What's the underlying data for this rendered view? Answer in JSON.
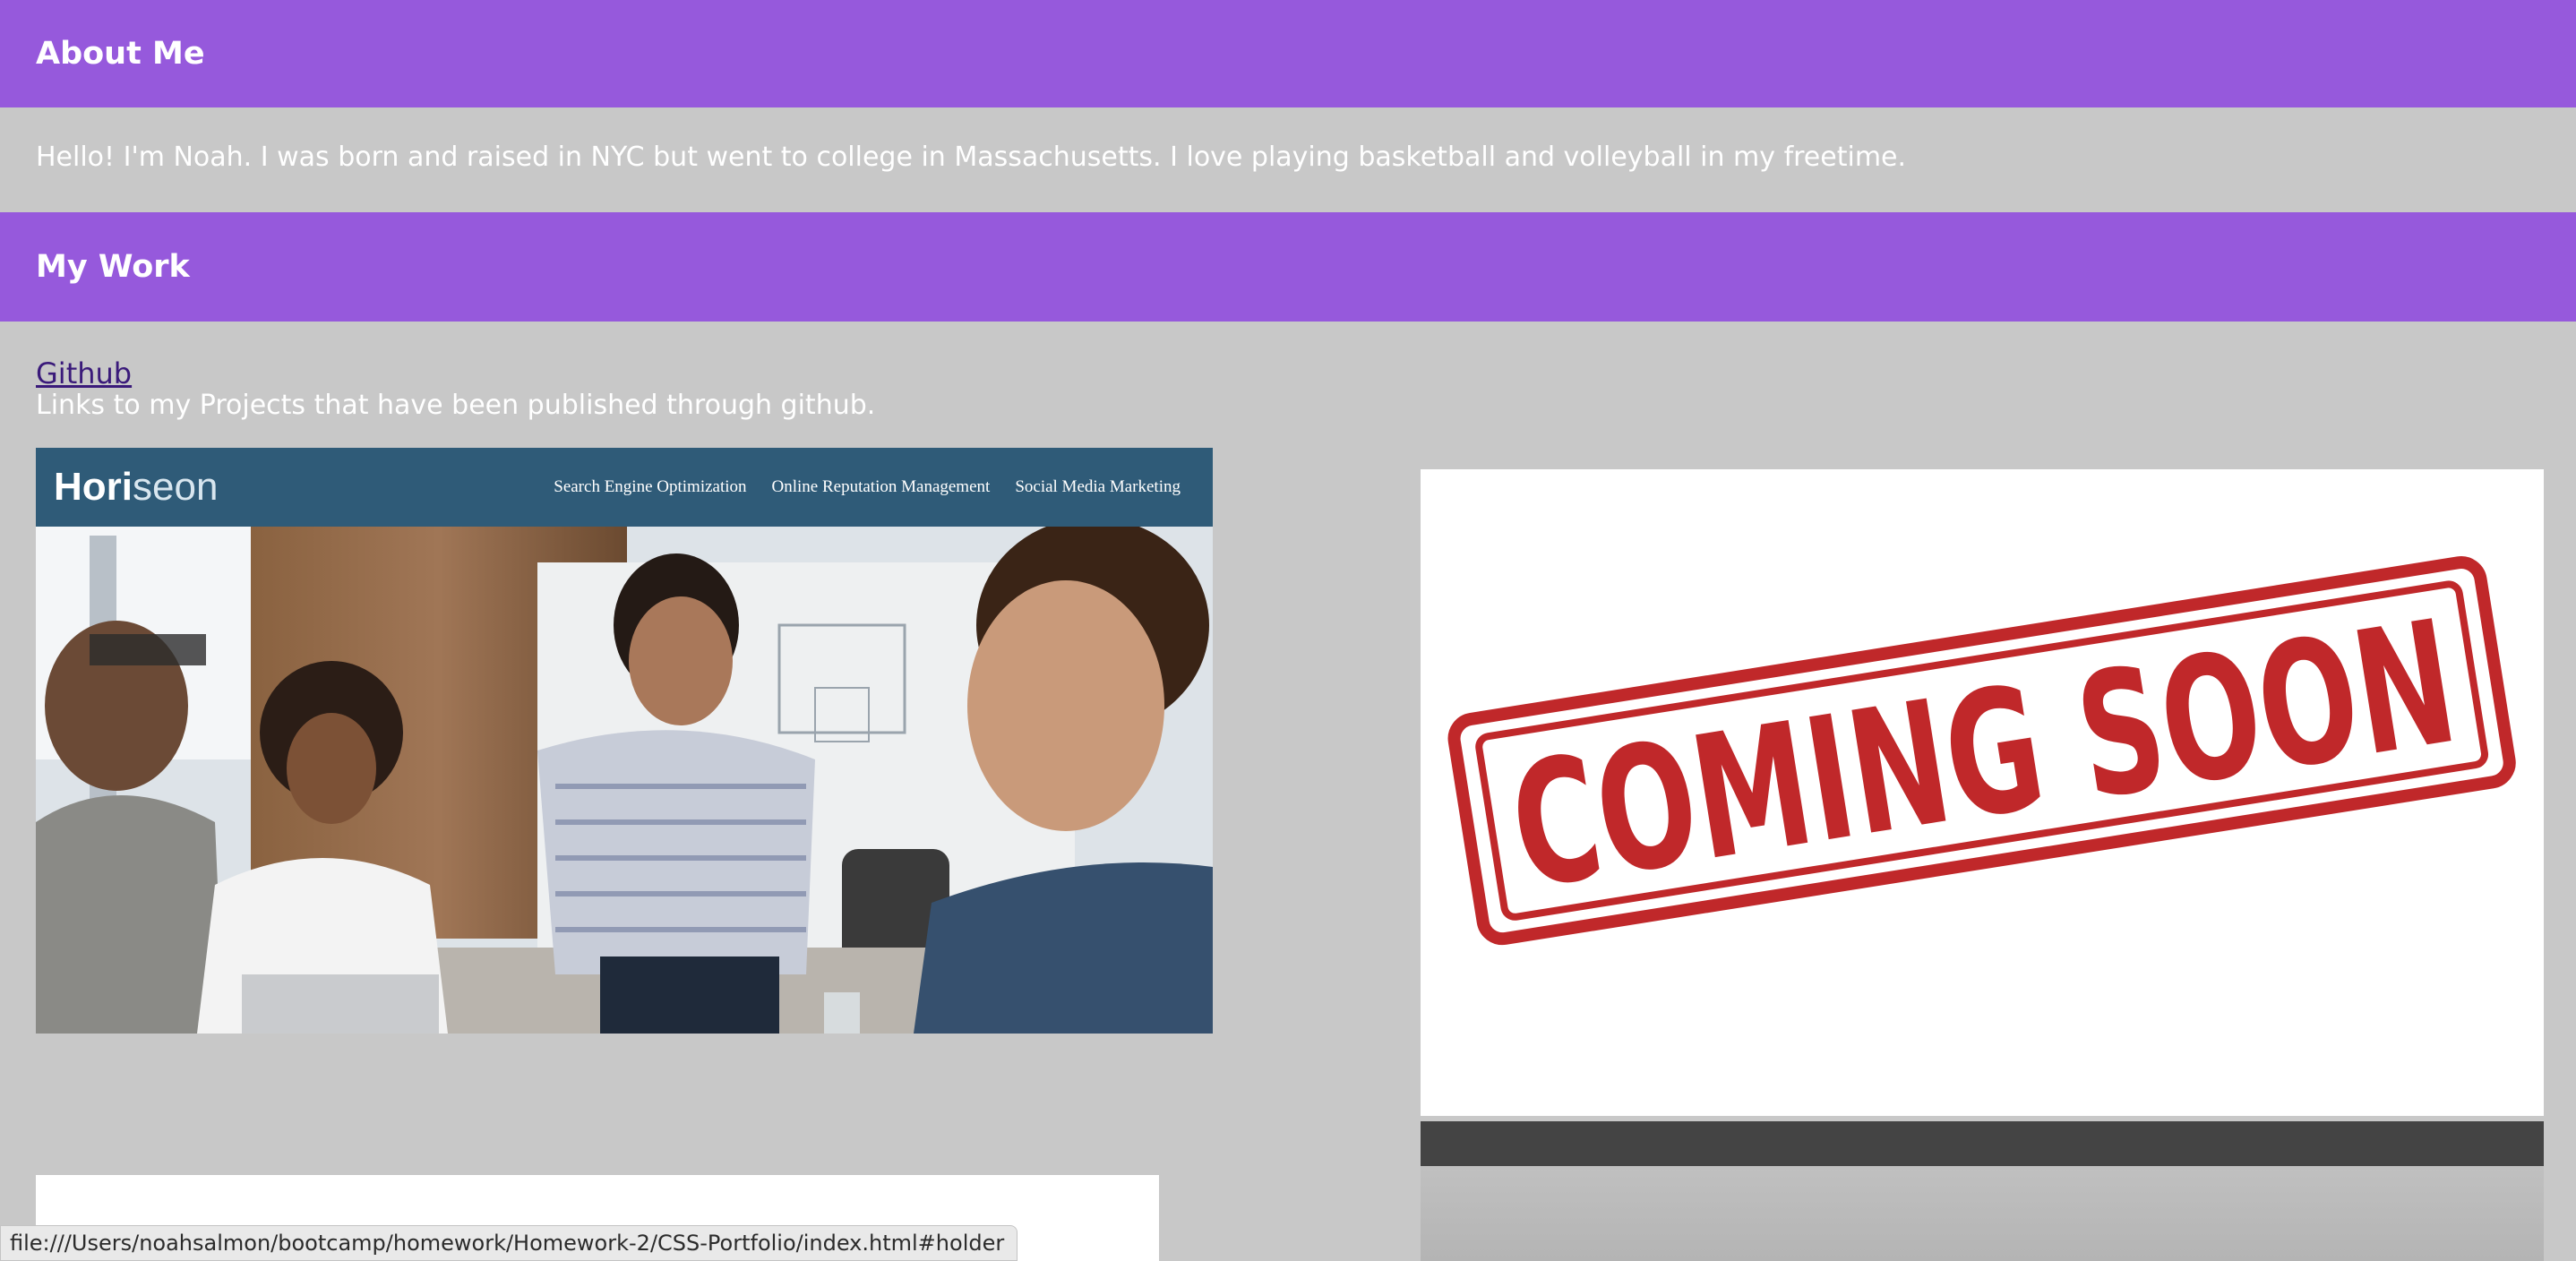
{
  "about": {
    "heading": "About Me",
    "text": "Hello! I'm Noah. I was born and raised in NYC but went to college in Massachusetts. I love playing basketball and volleyball in my freetime."
  },
  "work": {
    "heading": "My Work",
    "github_link": "Github",
    "github_desc": "Links to my Projects that have been published through github."
  },
  "horiseon": {
    "logo_a": "Hori",
    "logo_b": "seon",
    "nav": [
      "Search Engine Optimization",
      "Online Reputation Management",
      "Social Media Marketing"
    ]
  },
  "coming_soon": {
    "stamp_text": "COMING SOON"
  },
  "status_bar": {
    "url": "file:///Users/noahsalmon/bootcamp/homework/Homework-2/CSS-Portfolio/index.html#holder"
  },
  "colors": {
    "accent": "#9659dc",
    "background": "#c8c8c8",
    "horiseon_nav": "#2f5b78",
    "stamp_red": "#c0282a"
  }
}
